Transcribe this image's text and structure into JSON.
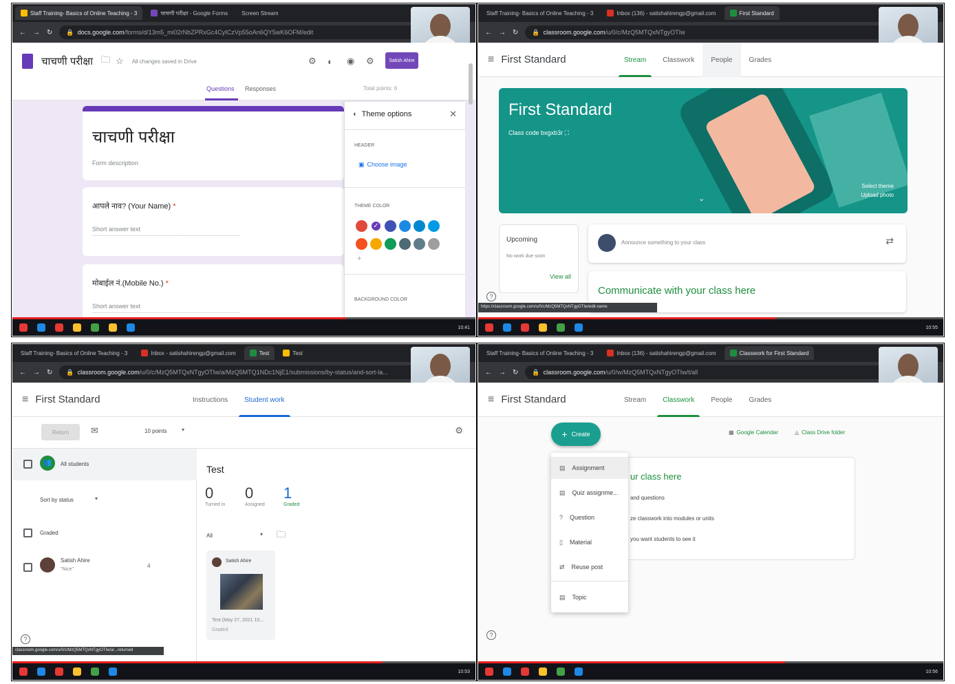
{
  "panel1": {
    "tabs": [
      "Staff Training- Basics of Online Teaching - 3",
      "चाचणी परीक्षा - Google Forms",
      "Screen Stream"
    ],
    "url_host": "docs.google.com",
    "url_path": "/forms/d/13m5_mi02rNbZPRxGc4CyICzVp55oAn6QY5wK6OFM/edit",
    "form_title": "चाचणी परीक्षा",
    "save_status": "All changes saved in Drive",
    "send_label": "Satish Ahire",
    "tab_questions": "Questions",
    "tab_responses": "Responses",
    "total_points": "Total points: 6",
    "header_title": "चाचणी परीक्षा",
    "form_description": "Form description",
    "q1_label": "आपले नाव? (Your Name)",
    "q1_required": "*",
    "q1_placeholder": "Short answer text",
    "q2_label": "मोबाईल नं.(Mobile No.)",
    "q2_required": "*",
    "q2_placeholder": "Short answer text",
    "theme_options": "Theme options",
    "header_section": "HEADER",
    "choose_image": "Choose image",
    "theme_color": "THEME COLOR",
    "background_color": "BACKGROUND COLOR",
    "colors_row1": [
      "#e04a3c",
      "#673ab7",
      "#3f51b5",
      "#1e88e5",
      "#0288d1",
      "#039be5"
    ],
    "colors_row2": [
      "#f4511e",
      "#f6a700",
      "#0f9d58",
      "#4e6a74",
      "#607d8b",
      "#9e9e9e"
    ],
    "selected_color": "#673ab7",
    "time": "10:41"
  },
  "panel2": {
    "tabs": [
      "Staff Training- Basics of Online Teaching - 3",
      "Inbox (136) - satishahirengp@gmail.com",
      "First Standard"
    ],
    "url_host": "classroom.google.com",
    "url_path": "/u/0/c/MzQ5MTQxNTgyOTIw",
    "class_name": "First Standard",
    "nav": [
      "Stream",
      "Classwork",
      "People",
      "Grades"
    ],
    "banner_title": "First Standard",
    "class_code_label": "Class code",
    "class_code": "bxgxb3r",
    "select_theme": "Select theme",
    "upload_photo": "Upload photo",
    "upcoming": "Upcoming",
    "no_work": "No work due soon",
    "view_all": "View all",
    "announce_placeholder": "Announce something to your class",
    "communicate": "Communicate with your class here",
    "status_url": "https://classroom.google.com/u/0/c/MzQ5MTQxNTgyOTIw/edit-name",
    "time": "10:55"
  },
  "panel3": {
    "tabs": [
      "Staff Training- Basics of Online Teaching - 3",
      "Inbox - satishahirengp@gmail.com",
      "Test",
      "Test"
    ],
    "url_host": "classroom.google.com",
    "url_path": "/u/0/c/MzQ5MTQxNTgyOTIw/a/MzQ5MTQ1NDc1NjE1/submissions/by-status/and-sort-la...",
    "class_name": "First Standard",
    "nav": [
      "Instructions",
      "Student work"
    ],
    "return_label": "Return",
    "points": "10 points",
    "all_students": "All students",
    "sort_by": "Sort by status",
    "graded": "Graded",
    "student_name": "Satish Ahire",
    "student_note": "\"Nice\"",
    "student_grade": "4",
    "assignment_title": "Test",
    "stats": [
      {
        "value": "0",
        "label": "Turned in"
      },
      {
        "value": "0",
        "label": "Assigned"
      },
      {
        "value": "1",
        "label": "Graded"
      }
    ],
    "filter": "All",
    "card_name": "Satish Ahire",
    "card_file": "Test (May 27, 2021 10...",
    "card_status": "Graded",
    "status_url": "classroom.google.com/u/0/c/MzQ5MTQxNTgyOTIw/a/...returned",
    "time": "10:53"
  },
  "panel4": {
    "tabs": [
      "Staff Training- Basics of Online Teaching - 3",
      "Inbox (136) - satishahirengp@gmail.com",
      "Classwork for First Standard"
    ],
    "url_host": "classroom.google.com",
    "url_path": "/u/0/w/MzQ5MTQxNTgyOTIw/t/all",
    "class_name": "First Standard",
    "nav": [
      "Stream",
      "Classwork",
      "People",
      "Grades"
    ],
    "create": "Create",
    "calendar": "Google Calendar",
    "drive": "Class Drive folder",
    "menu": [
      "Assignment",
      "Quiz assignme...",
      "Question",
      "Material",
      "Reuse post",
      "Topic"
    ],
    "bg_title": "ur class here",
    "bg_line1": "and questions",
    "bg_line2": "ze classwork into modules or units",
    "bg_line3": "you want students to see it",
    "time": "10:56"
  }
}
